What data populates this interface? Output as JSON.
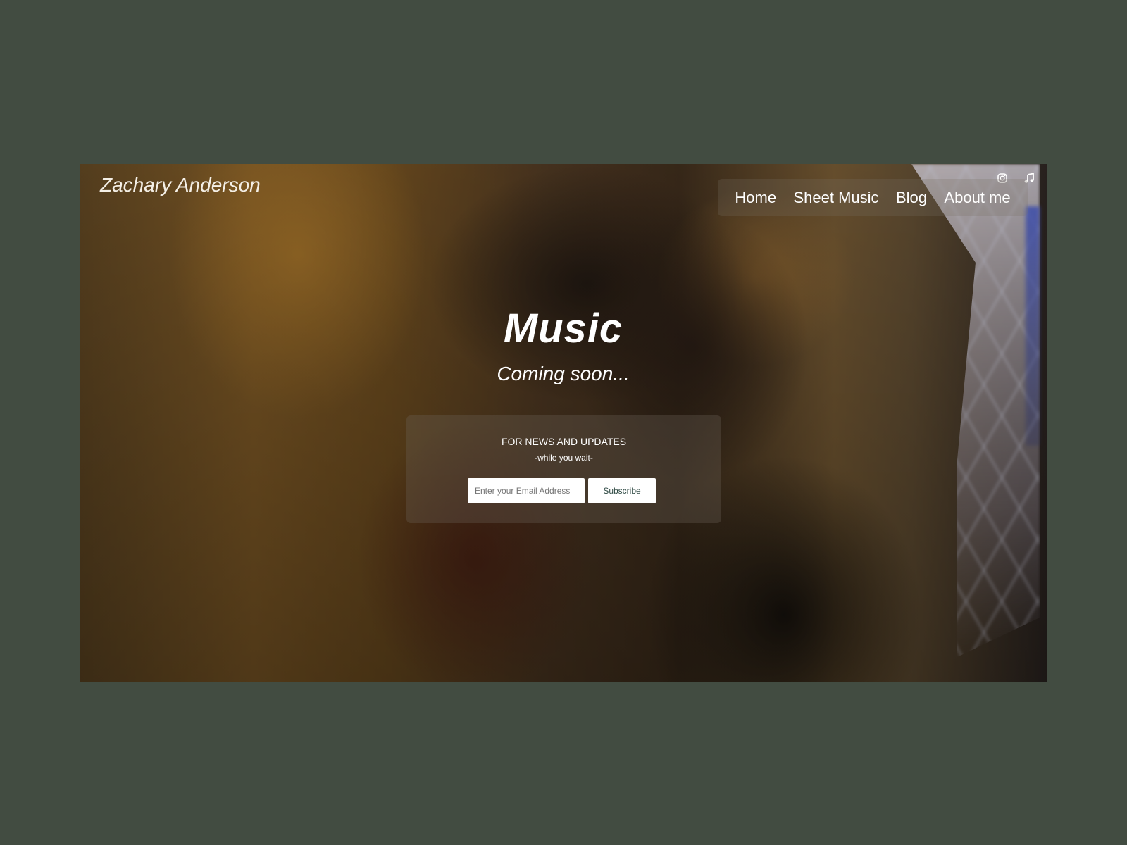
{
  "header": {
    "brand": "Zachary Anderson"
  },
  "nav": {
    "items": [
      {
        "label": "Home"
      },
      {
        "label": "Sheet Music"
      },
      {
        "label": "Blog"
      },
      {
        "label": "About me"
      }
    ]
  },
  "social": {
    "icons": [
      "instagram-icon",
      "music-note-icon"
    ]
  },
  "hero": {
    "title": "Music",
    "subtitle": "Coming soon..."
  },
  "signup": {
    "heading": "FOR NEWS AND UPDATES",
    "subheading": "-while you wait-",
    "email_placeholder": "Enter your Email Address",
    "button_label": "Subscribe"
  },
  "colors": {
    "page_background": "#424c41",
    "button_text": "#2f4a44",
    "text": "#ffffff"
  }
}
